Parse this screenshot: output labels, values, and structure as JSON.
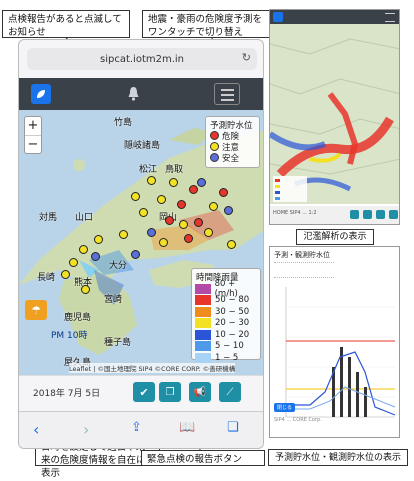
{
  "callouts": {
    "blink": "点検報告があると点滅してお知らせ",
    "switch": "地震・豪雨の危険度予測をワンタッチで切り替え",
    "history": "日時を設定して過去や未来の危険度情報を自在に表示",
    "report": "緊急点検の報告ボタン"
  },
  "captions": {
    "flood": "氾濫解析の表示",
    "level": "予測貯水位・観測貯水位の表示"
  },
  "browser": {
    "url": "sipcat.iotm2m.in"
  },
  "map": {
    "zoom_in": "+",
    "zoom_out": "−",
    "legend_title": "予測貯水位",
    "legend_items": [
      {
        "label": "危険",
        "color": "#e8352b"
      },
      {
        "label": "注意",
        "color": "#f3e124"
      },
      {
        "label": "安全",
        "color": "#5a6fd8"
      }
    ],
    "rain_title": "時間降雨量",
    "rain_items": [
      {
        "label": "80 + (m/h)",
        "color": "#b44aa8"
      },
      {
        "label": "50 − 80",
        "color": "#e8352b"
      },
      {
        "label": "30 − 50",
        "color": "#f08c1e"
      },
      {
        "label": "20 − 30",
        "color": "#f3e124"
      },
      {
        "label": "10 − 20",
        "color": "#2a55d8"
      },
      {
        "label": "5 − 10",
        "color": "#4f9ae8"
      },
      {
        "label": "1 − 5",
        "color": "#a9d3f5"
      }
    ],
    "places": [
      "竹島",
      "隠岐諸島",
      "松江",
      "鳥取",
      "対馬",
      "山口",
      "岡山",
      "長崎",
      "熊本",
      "大分",
      "宮崎",
      "鹿児島",
      "種子島",
      "屋久島"
    ],
    "time_label": "PM 10時",
    "attribution": "Leaflet | ©国土地理院 SIP4 ©CORE CORP. ©善研機構"
  },
  "toolbar": {
    "date": "2018年 7月 5日"
  },
  "shot1": {
    "footer": "HOME  SIP4 ... 1:2"
  },
  "shot2": {
    "title": "予測・観測貯水位",
    "button": "閉じる",
    "footnote": "SIP4 ... CORE Corp."
  },
  "colors": {
    "accent": "#1e8fa5",
    "brand": "#1a73e8",
    "navbar": "#3b4149"
  }
}
